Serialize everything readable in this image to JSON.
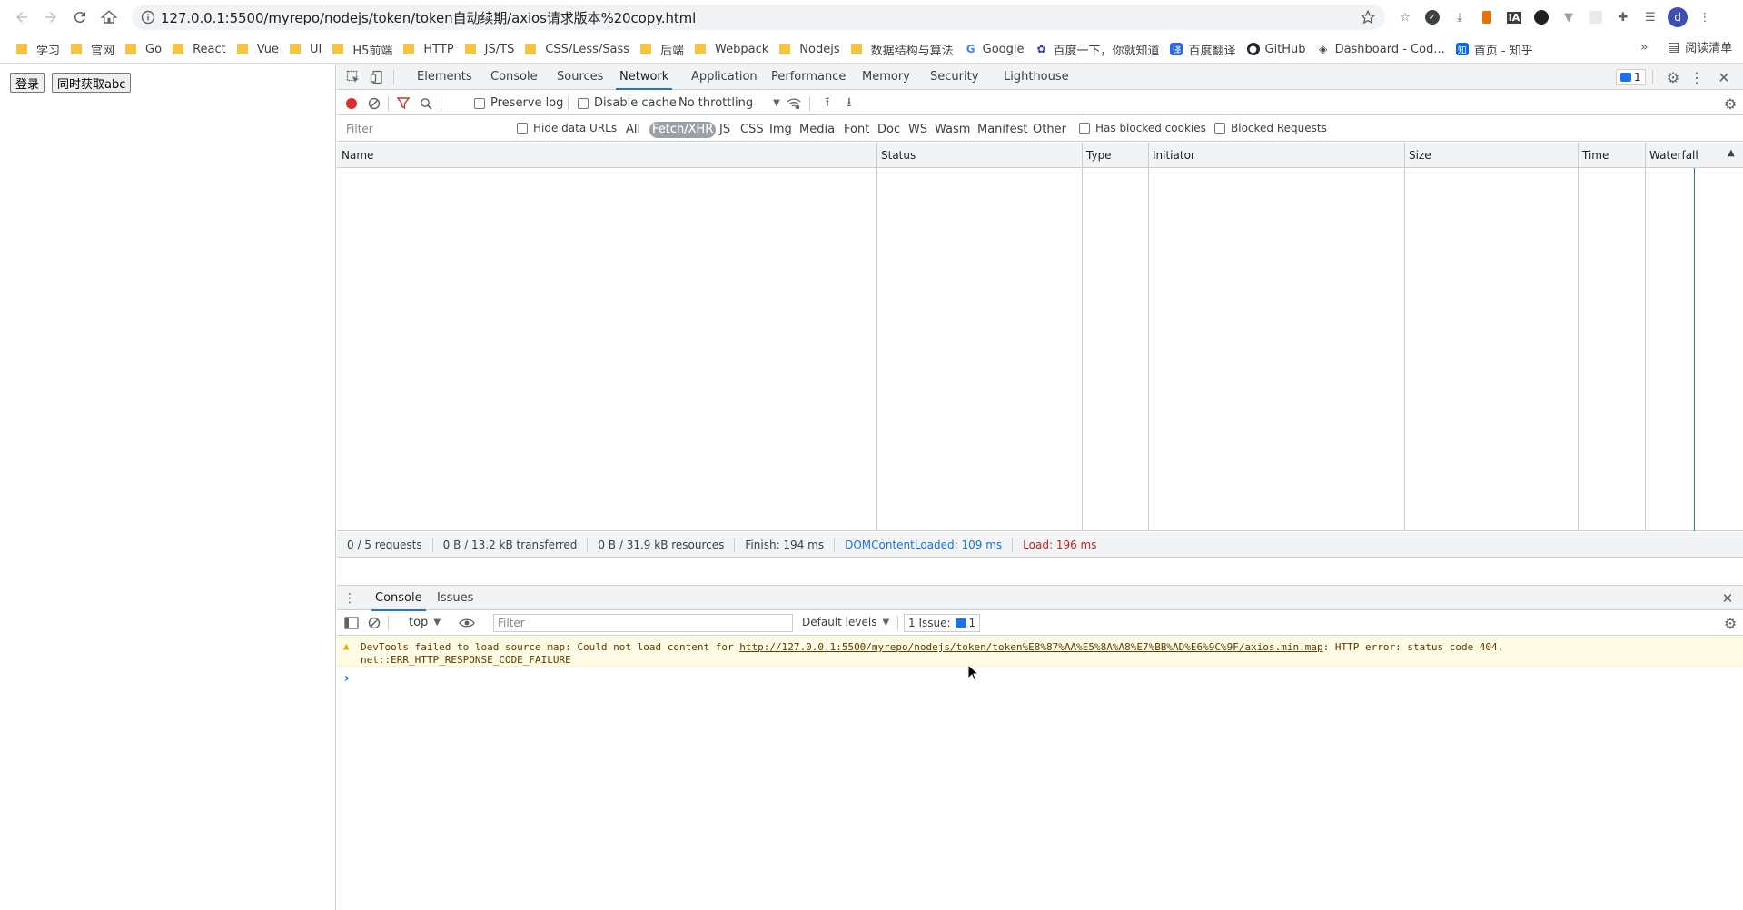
{
  "browser": {
    "url": "127.0.0.1:5500/myrepo/nodejs/token/token自动续期/axios请求版本%20copy.html",
    "bookmarks": [
      "学习",
      "官网",
      "Go",
      "React",
      "Vue",
      "UI",
      "H5前端",
      "HTTP",
      "JS/TS",
      "CSS/Less/Sass",
      "后端",
      "Webpack",
      "Nodejs",
      "数据结构与算法"
    ],
    "bookmarks_sites": [
      "Google",
      "百度一下，你就知道",
      "百度翻译",
      "GitHub",
      "Dashboard - Cod...",
      "首页 - 知乎"
    ],
    "reading_list": "阅读清单",
    "more": "»",
    "avatar": "d"
  },
  "page": {
    "login_button": "登录",
    "fetch_button": "同时获取abc"
  },
  "devtools": {
    "tabs": [
      "Elements",
      "Console",
      "Sources",
      "Network",
      "Application",
      "Performance",
      "Memory",
      "Security",
      "Lighthouse"
    ],
    "active_tab": "Network",
    "issues_count": "1",
    "network_toolbar": {
      "preserve_log": "Preserve log",
      "disable_cache": "Disable cache",
      "throttling": "No throttling"
    },
    "filter": {
      "placeholder": "Filter",
      "hide_data_urls": "Hide data URLs",
      "types": [
        "All",
        "Fetch/XHR",
        "JS",
        "CSS",
        "Img",
        "Media",
        "Font",
        "Doc",
        "WS",
        "Wasm",
        "Manifest",
        "Other"
      ],
      "active_type": "Fetch/XHR",
      "has_blocked_cookies": "Has blocked cookies",
      "blocked_requests": "Blocked Requests"
    },
    "columns": [
      "Name",
      "Status",
      "Type",
      "Initiator",
      "Size",
      "Time",
      "Waterfall"
    ],
    "summary": {
      "requests": "0 / 5 requests",
      "transferred": "0 B / 13.2 kB transferred",
      "resources": "0 B / 31.9 kB resources",
      "finish": "Finish: 194 ms",
      "dom_loaded": "DOMContentLoaded: 109 ms",
      "load": "Load: 196 ms"
    },
    "drawer": {
      "tabs": [
        "Console",
        "Issues"
      ],
      "context": "top",
      "filter_placeholder": "Filter",
      "levels": "Default levels",
      "issues_label": "1 Issue:",
      "issues_count": "1",
      "warning_prefix": "DevTools failed to load source map: Could not load content for ",
      "warning_link": "http://127.0.0.1:5500/myrepo/nodejs/token/token%E8%87%AA%E5%8A%A8%E7%BB%AD%E6%9C%9F/axios.min.map",
      "warning_suffix": ": HTTP error: status code 404,",
      "warning_line2": "net::ERR_HTTP_RESPONSE_CODE_FAILURE",
      "prompt": "›"
    },
    "colors": {
      "accent": "#1a73e8",
      "record": "#d93025",
      "dom_loaded": "#1a73e8",
      "load": "#c5221f",
      "warning_bg": "#fffbe5"
    }
  }
}
